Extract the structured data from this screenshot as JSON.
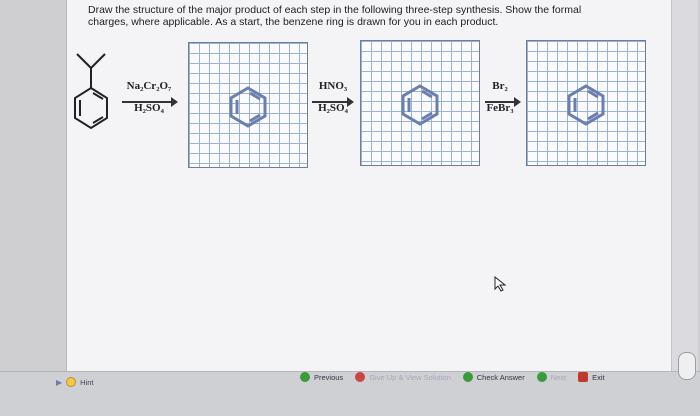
{
  "question": {
    "line1": "Draw the structure of the major product of each step in the following three-step synthesis. Show the formal",
    "line2": "charges, where applicable. As a start, the benzene ring is drawn for you in each product."
  },
  "steps": [
    {
      "reagent_top": "Na₂Cr₂O₇",
      "reagent_bottom": "H₂SO₄"
    },
    {
      "reagent_top": "HNO₃",
      "reagent_bottom": "H₂SO₄"
    },
    {
      "reagent_top": "Br₂",
      "reagent_bottom": "FeBr₃"
    }
  ],
  "buttons": {
    "previous": "Previous",
    "give_up": "Give Up & View Solution",
    "check": "Check Answer",
    "next": "Next",
    "exit": "Exit"
  },
  "hint": {
    "label": "Hint"
  },
  "colors": {
    "grid_line": "#9ab4d8",
    "ring": "#6a7fb0",
    "accent_green": "#3a9b3a"
  }
}
